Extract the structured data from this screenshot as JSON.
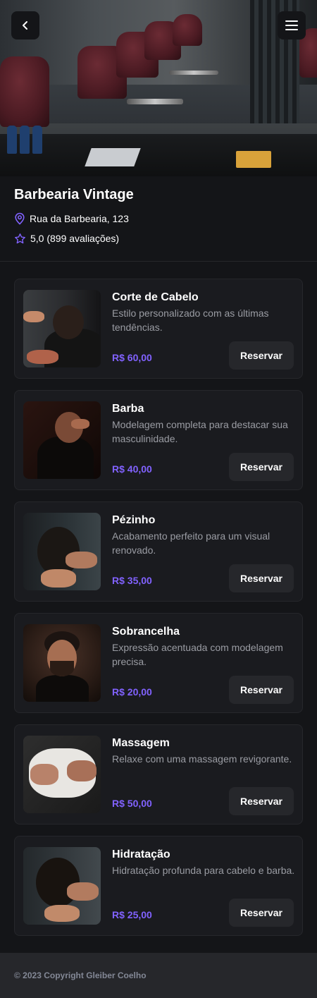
{
  "header": {
    "back_icon": "chevron-left-icon",
    "menu_icon": "hamburger-menu-icon",
    "image_alt": "barbershop interior with vintage chairs"
  },
  "shop": {
    "name": "Barbearia Vintage",
    "address": "Rua da Barbearia, 123",
    "rating": "5,0 (899 avaliações)",
    "address_icon": "map-pin-icon",
    "rating_icon": "star-icon"
  },
  "services": [
    {
      "title": "Corte de Cabelo",
      "description": "Estilo personalizado com as últimas tendências.",
      "price": "R$ 60,00",
      "button": "Reservar"
    },
    {
      "title": "Barba",
      "description": "Modelagem completa para destacar sua masculinidade.",
      "price": "R$ 40,00",
      "button": "Reservar"
    },
    {
      "title": "Pézinho",
      "description": "Acabamento perfeito para um visual renovado.",
      "price": "R$ 35,00",
      "button": "Reservar"
    },
    {
      "title": "Sobrancelha",
      "description": "Expressão acentuada com modelagem precisa.",
      "price": "R$ 20,00",
      "button": "Reservar"
    },
    {
      "title": "Massagem",
      "description": "Relaxe com uma massagem revigorante.",
      "price": "R$ 50,00",
      "button": "Reservar"
    },
    {
      "title": "Hidratação",
      "description": "Hidratação profunda para cabelo e barba.",
      "price": "R$ 25,00",
      "button": "Reservar"
    }
  ],
  "footer": {
    "copyright": "© 2023 Copyright Gleiber Coelho"
  },
  "colors": {
    "background": "#141518",
    "card": "#1a1b1f",
    "accent": "#8162ff",
    "muted_text": "#9a9ca3",
    "button": "#26272b"
  }
}
